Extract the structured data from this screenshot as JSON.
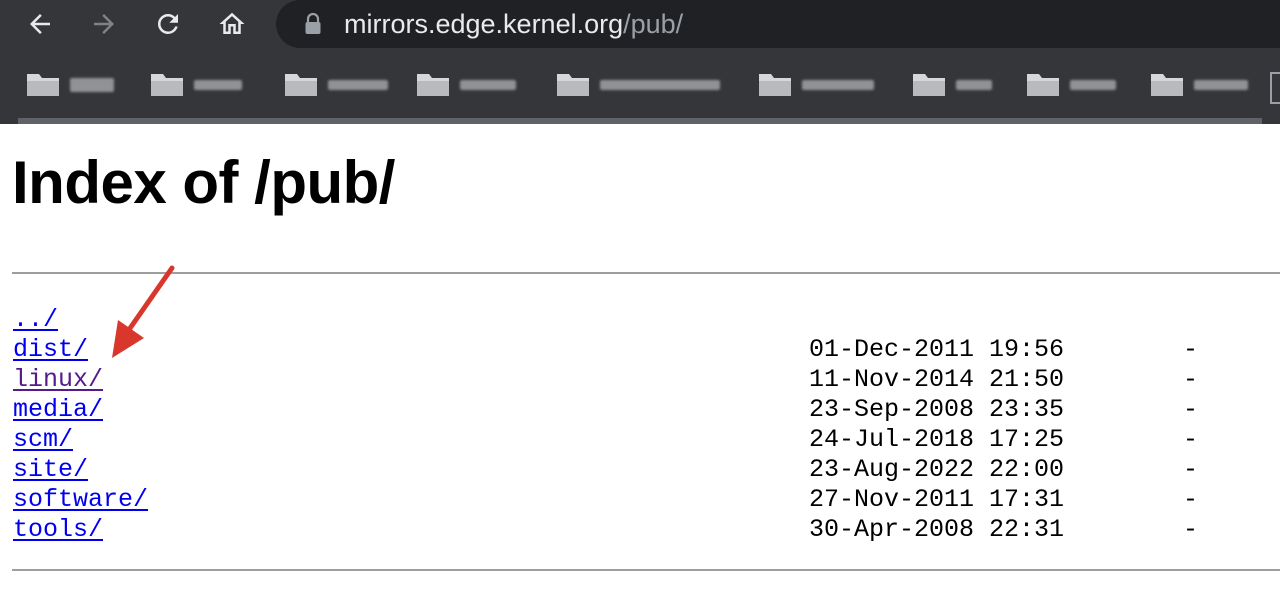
{
  "browser": {
    "url_host": "mirrors.edge.kernel.org",
    "url_path": "/pub/",
    "nav": {
      "back_icon": "arrow-left-icon",
      "forward_icon": "arrow-right-icon",
      "reload_icon": "reload-icon",
      "home_icon": "home-icon",
      "lock_icon": "lock-icon"
    }
  },
  "page": {
    "title": "Index of /pub/",
    "parent_link": "../",
    "entries": [
      {
        "name": "dist/",
        "date": "01-Dec-2011 19:56",
        "size": "-",
        "visited": false
      },
      {
        "name": "linux/",
        "date": "11-Nov-2014 21:50",
        "size": "-",
        "visited": true
      },
      {
        "name": "media/",
        "date": "23-Sep-2008 23:35",
        "size": "-",
        "visited": false
      },
      {
        "name": "scm/",
        "date": "24-Jul-2018 17:25",
        "size": "-",
        "visited": false
      },
      {
        "name": "site/",
        "date": "23-Aug-2022 22:00",
        "size": "-",
        "visited": false
      },
      {
        "name": "software/",
        "date": "27-Nov-2011 17:31",
        "size": "-",
        "visited": false
      },
      {
        "name": "tools/",
        "date": "30-Apr-2008 22:31",
        "size": "-",
        "visited": false
      }
    ]
  },
  "colors": {
    "link": "#0000ee",
    "visited_link": "#551a8b",
    "annotation_arrow": "#d9372b",
    "chrome_bg": "#35363a"
  }
}
